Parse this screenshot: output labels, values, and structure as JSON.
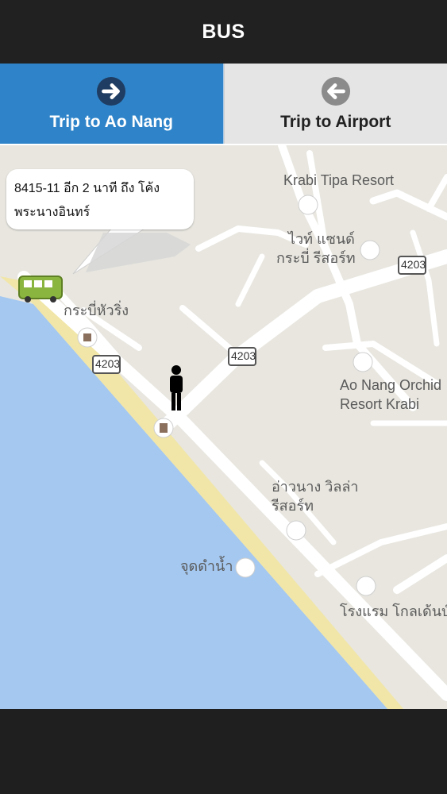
{
  "header": {
    "title": "BUS"
  },
  "tabs": [
    {
      "label": "Trip to Ao Nang",
      "icon": "arrow-right-circle-icon",
      "active": true
    },
    {
      "label": "Trip to Airport",
      "icon": "arrow-left-circle-icon",
      "active": false
    }
  ],
  "map": {
    "bubble_text": "8415-11 อีก 2 นาที ถึง โค้งพระนางอินทร์",
    "places": {
      "krabi_tipa": "Krabi Tipa Resort",
      "white_sand_1": "ไวท์ แซนด์",
      "white_sand_2": "กระบี่ รีสอร์ท",
      "aonang_orchid_1": "Ao Nang Orchid",
      "aonang_orchid_2": "Resort Krabi",
      "krabi_hua_ring": "กระบี่หัวริ่ง",
      "ao_nang_villa_1": "อ่าวนาง วิลล่า",
      "ao_nang_villa_2": "รีสอร์ท",
      "viewpoint": "จุดดำน้ำ",
      "golden_hotel": "โรงแรม โกลเด้นบ์"
    },
    "route_shields": [
      "4203",
      "4203",
      "4203"
    ]
  },
  "colors": {
    "header_bg": "#212121",
    "active_tab": "#2f84c9",
    "inactive_tab": "#e5e5e5",
    "sea": "#a4c8f0",
    "beach": "#f1e6a8",
    "land": "#e8e6df",
    "road": "#ffffff",
    "bus": "#8ab53f"
  }
}
